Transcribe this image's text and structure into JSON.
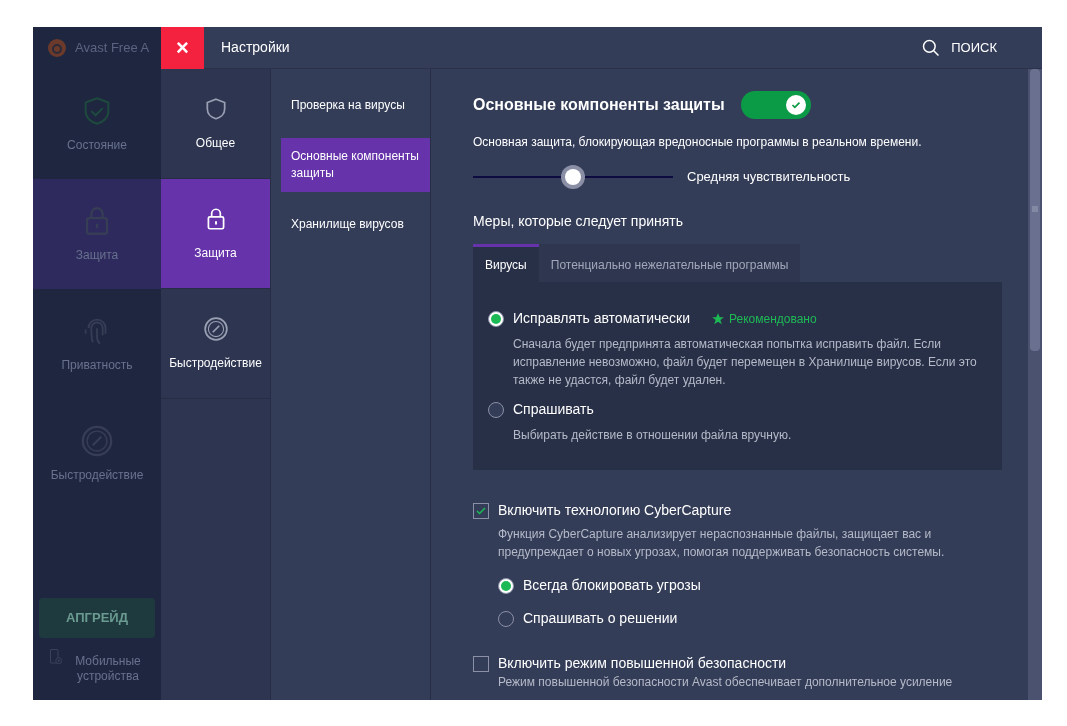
{
  "background_app": {
    "title": "Avast Free A",
    "nav": [
      {
        "label": "Состояние",
        "selected": false
      },
      {
        "label": "Защита",
        "selected": true
      },
      {
        "label": "Приватность",
        "selected": false
      },
      {
        "label": "Быстродействие",
        "selected": false
      }
    ],
    "upgrade_button": "АПГРЕЙД",
    "mobile_link": "Мобильные устройства"
  },
  "settings": {
    "close_button": "×",
    "title": "Настройки",
    "search_label": "ПОИСК",
    "categories": [
      {
        "label": "Общее",
        "selected": false
      },
      {
        "label": "Защита",
        "selected": true
      },
      {
        "label": "Быстродействие",
        "selected": false
      }
    ],
    "subsections": [
      {
        "label": "Проверка на вирусы",
        "selected": false
      },
      {
        "label": "Основные компоненты защиты",
        "selected": true
      },
      {
        "label": "Хранилище вирусов",
        "selected": false
      }
    ],
    "content": {
      "title": "Основные компоненты защиты",
      "toggle_on": true,
      "description": "Основная защита, блокирующая вредоносные программы в реальном времени.",
      "sensitivity": {
        "level": 0.5,
        "label": "Средняя чувствительность"
      },
      "measures_title": "Меры, которые следует принять",
      "measure_tabs": [
        {
          "label": "Вирусы",
          "selected": true
        },
        {
          "label": "Потенциально нежелательные программы",
          "selected": false
        }
      ],
      "measure_options": [
        {
          "label": "Исправлять автоматически",
          "selected": true,
          "badge": "Рекомендовано",
          "description": "Сначала будет предпринята автоматическая попытка исправить файл. Если исправление невозможно, файл будет перемещен в Хранилище вирусов. Если это также не удастся, файл будет удален."
        },
        {
          "label": "Спрашивать",
          "selected": false,
          "description": "Выбирать действие в отношении файла вручную."
        }
      ],
      "checkboxes": [
        {
          "label": "Включить технологию CyberCapture",
          "checked": true,
          "description": "Функция CyberCapture анализирует нераспознанные файлы, защищает вас и предупреждает о новых угрозах, помогая поддерживать безопасность системы.",
          "options": [
            {
              "label": "Всегда блокировать угрозы",
              "selected": true
            },
            {
              "label": "Спрашивать о решении",
              "selected": false
            }
          ]
        },
        {
          "label": "Включить режим повышенной безопасности",
          "checked": false,
          "description": "Режим повышенной безопасности Avast обеспечивает дополнительное усиление"
        }
      ]
    }
  }
}
